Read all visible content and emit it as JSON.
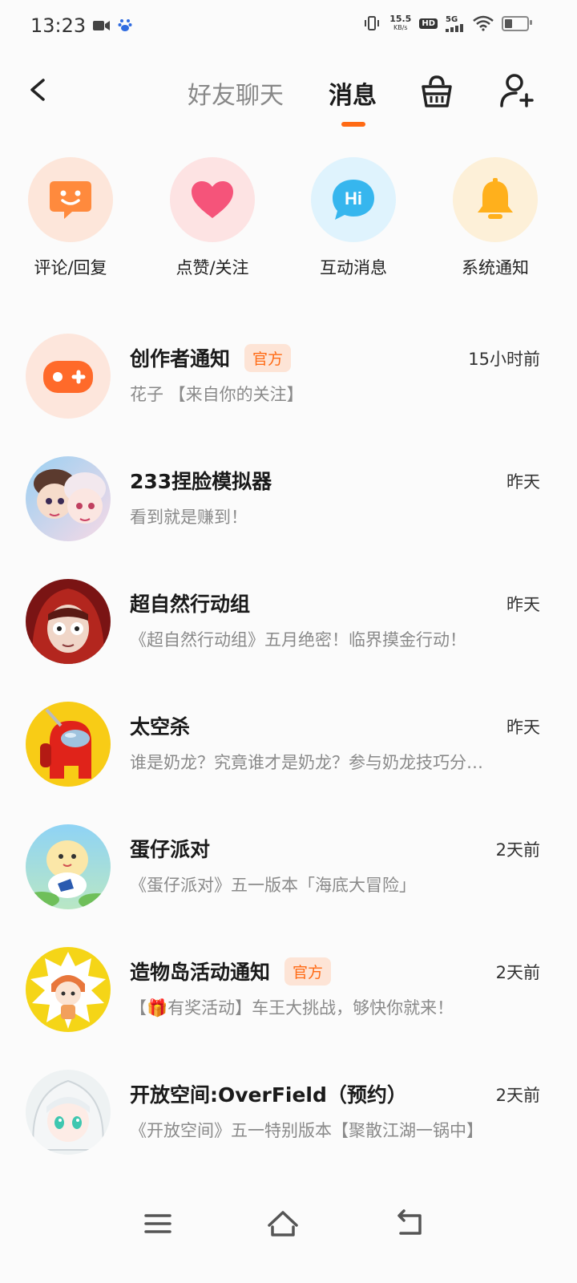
{
  "status_bar": {
    "time": "13:23",
    "net_speed_value": "15.5",
    "net_speed_unit": "KB/s",
    "hd_label": "HD",
    "network_label": "5G",
    "battery_level": 0.35,
    "icons": [
      "video-camera-icon",
      "baidu-icon",
      "vibrate-icon",
      "signal-icon",
      "wifi-icon",
      "battery-icon"
    ]
  },
  "header": {
    "tabs": [
      {
        "label": "好友聊天",
        "active": false
      },
      {
        "label": "消息",
        "active": true
      }
    ],
    "accent_color": "#ff6a14",
    "icons": [
      "back-arrow-icon",
      "basket-icon",
      "add-friend-icon"
    ]
  },
  "quick_entries": [
    {
      "label": "评论/回复",
      "icon": "comment-smile-icon",
      "bg": "#fde6da",
      "color": "#ff8a3d"
    },
    {
      "label": "点赞/关注",
      "icon": "heart-icon",
      "bg": "#fde3e3",
      "color": "#f5547a"
    },
    {
      "label": "互动消息",
      "icon": "hi-bubble-icon",
      "bg": "#dff3fd",
      "color": "#36b6ee"
    },
    {
      "label": "系统通知",
      "icon": "bell-icon",
      "bg": "#fdf0d8",
      "color": "#ffb01c"
    }
  ],
  "messages": [
    {
      "title": "创作者通知",
      "badge": "官方",
      "time": "15小时前",
      "preview": "花子 【来自你的关注】",
      "avatar": "gamepad-icon"
    },
    {
      "title": "233捏脸模拟器",
      "badge": "",
      "time": "昨天",
      "preview": "看到就是赚到！",
      "avatar": "anime-girls-avatar"
    },
    {
      "title": "超自然行动组",
      "badge": "",
      "time": "昨天",
      "preview": "《超自然行动组》五月绝密！临界摸金行动！",
      "avatar": "red-hood-girl-avatar"
    },
    {
      "title": "太空杀",
      "badge": "",
      "time": "昨天",
      "preview": "谁是奶龙？究竟谁才是奶龙？参与奶龙技巧分…",
      "avatar": "red-crewmate-avatar"
    },
    {
      "title": "蛋仔派对",
      "badge": "",
      "time": "2天前",
      "preview": "《蛋仔派对》五一版本「海底大冒险」",
      "avatar": "eggy-avatar"
    },
    {
      "title": "造物岛活动通知",
      "badge": "官方",
      "time": "2天前",
      "preview": "【🎁有奖活动】车王大挑战，够快你就来！",
      "avatar": "comic-girl-avatar"
    },
    {
      "title": "开放空间:OverField（预约）",
      "badge": "",
      "time": "2天前",
      "preview": "《开放空间》五一特别版本【聚散江湖一锅中】",
      "avatar": "white-hair-girl-avatar"
    }
  ],
  "nav_bar": {
    "icons": [
      "menu-icon",
      "home-icon",
      "back-icon"
    ]
  }
}
